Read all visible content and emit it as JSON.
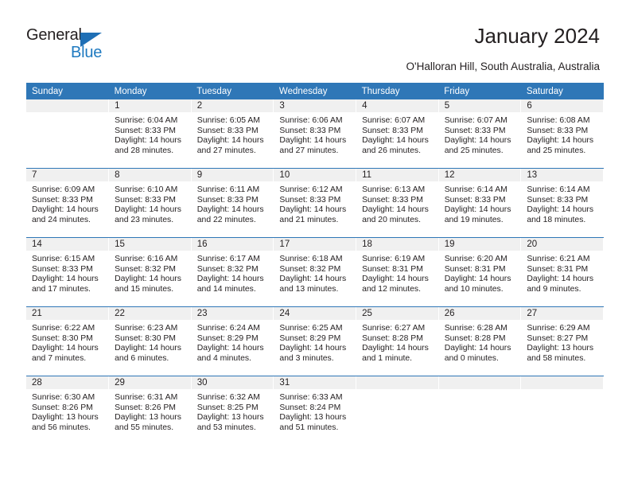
{
  "brand": {
    "name_part1": "General",
    "name_part2": "Blue",
    "accent_color": "#1f7ac0",
    "triangle_color": "#1f6fb5"
  },
  "header": {
    "title": "January 2024",
    "subtitle": "O'Halloran Hill, South Australia, Australia"
  },
  "calendar": {
    "header_bg": "#2f77b7",
    "date_bar_bg": "#f0f0f0",
    "weekday_labels": [
      "Sunday",
      "Monday",
      "Tuesday",
      "Wednesday",
      "Thursday",
      "Friday",
      "Saturday"
    ],
    "weeks": [
      [
        {
          "date": "",
          "sunrise": "",
          "sunset": "",
          "daylight_line1": "",
          "daylight_line2": ""
        },
        {
          "date": "1",
          "sunrise": "Sunrise: 6:04 AM",
          "sunset": "Sunset: 8:33 PM",
          "daylight_line1": "Daylight: 14 hours",
          "daylight_line2": "and 28 minutes."
        },
        {
          "date": "2",
          "sunrise": "Sunrise: 6:05 AM",
          "sunset": "Sunset: 8:33 PM",
          "daylight_line1": "Daylight: 14 hours",
          "daylight_line2": "and 27 minutes."
        },
        {
          "date": "3",
          "sunrise": "Sunrise: 6:06 AM",
          "sunset": "Sunset: 8:33 PM",
          "daylight_line1": "Daylight: 14 hours",
          "daylight_line2": "and 27 minutes."
        },
        {
          "date": "4",
          "sunrise": "Sunrise: 6:07 AM",
          "sunset": "Sunset: 8:33 PM",
          "daylight_line1": "Daylight: 14 hours",
          "daylight_line2": "and 26 minutes."
        },
        {
          "date": "5",
          "sunrise": "Sunrise: 6:07 AM",
          "sunset": "Sunset: 8:33 PM",
          "daylight_line1": "Daylight: 14 hours",
          "daylight_line2": "and 25 minutes."
        },
        {
          "date": "6",
          "sunrise": "Sunrise: 6:08 AM",
          "sunset": "Sunset: 8:33 PM",
          "daylight_line1": "Daylight: 14 hours",
          "daylight_line2": "and 25 minutes."
        }
      ],
      [
        {
          "date": "7",
          "sunrise": "Sunrise: 6:09 AM",
          "sunset": "Sunset: 8:33 PM",
          "daylight_line1": "Daylight: 14 hours",
          "daylight_line2": "and 24 minutes."
        },
        {
          "date": "8",
          "sunrise": "Sunrise: 6:10 AM",
          "sunset": "Sunset: 8:33 PM",
          "daylight_line1": "Daylight: 14 hours",
          "daylight_line2": "and 23 minutes."
        },
        {
          "date": "9",
          "sunrise": "Sunrise: 6:11 AM",
          "sunset": "Sunset: 8:33 PM",
          "daylight_line1": "Daylight: 14 hours",
          "daylight_line2": "and 22 minutes."
        },
        {
          "date": "10",
          "sunrise": "Sunrise: 6:12 AM",
          "sunset": "Sunset: 8:33 PM",
          "daylight_line1": "Daylight: 14 hours",
          "daylight_line2": "and 21 minutes."
        },
        {
          "date": "11",
          "sunrise": "Sunrise: 6:13 AM",
          "sunset": "Sunset: 8:33 PM",
          "daylight_line1": "Daylight: 14 hours",
          "daylight_line2": "and 20 minutes."
        },
        {
          "date": "12",
          "sunrise": "Sunrise: 6:14 AM",
          "sunset": "Sunset: 8:33 PM",
          "daylight_line1": "Daylight: 14 hours",
          "daylight_line2": "and 19 minutes."
        },
        {
          "date": "13",
          "sunrise": "Sunrise: 6:14 AM",
          "sunset": "Sunset: 8:33 PM",
          "daylight_line1": "Daylight: 14 hours",
          "daylight_line2": "and 18 minutes."
        }
      ],
      [
        {
          "date": "14",
          "sunrise": "Sunrise: 6:15 AM",
          "sunset": "Sunset: 8:33 PM",
          "daylight_line1": "Daylight: 14 hours",
          "daylight_line2": "and 17 minutes."
        },
        {
          "date": "15",
          "sunrise": "Sunrise: 6:16 AM",
          "sunset": "Sunset: 8:32 PM",
          "daylight_line1": "Daylight: 14 hours",
          "daylight_line2": "and 15 minutes."
        },
        {
          "date": "16",
          "sunrise": "Sunrise: 6:17 AM",
          "sunset": "Sunset: 8:32 PM",
          "daylight_line1": "Daylight: 14 hours",
          "daylight_line2": "and 14 minutes."
        },
        {
          "date": "17",
          "sunrise": "Sunrise: 6:18 AM",
          "sunset": "Sunset: 8:32 PM",
          "daylight_line1": "Daylight: 14 hours",
          "daylight_line2": "and 13 minutes."
        },
        {
          "date": "18",
          "sunrise": "Sunrise: 6:19 AM",
          "sunset": "Sunset: 8:31 PM",
          "daylight_line1": "Daylight: 14 hours",
          "daylight_line2": "and 12 minutes."
        },
        {
          "date": "19",
          "sunrise": "Sunrise: 6:20 AM",
          "sunset": "Sunset: 8:31 PM",
          "daylight_line1": "Daylight: 14 hours",
          "daylight_line2": "and 10 minutes."
        },
        {
          "date": "20",
          "sunrise": "Sunrise: 6:21 AM",
          "sunset": "Sunset: 8:31 PM",
          "daylight_line1": "Daylight: 14 hours",
          "daylight_line2": "and 9 minutes."
        }
      ],
      [
        {
          "date": "21",
          "sunrise": "Sunrise: 6:22 AM",
          "sunset": "Sunset: 8:30 PM",
          "daylight_line1": "Daylight: 14 hours",
          "daylight_line2": "and 7 minutes."
        },
        {
          "date": "22",
          "sunrise": "Sunrise: 6:23 AM",
          "sunset": "Sunset: 8:30 PM",
          "daylight_line1": "Daylight: 14 hours",
          "daylight_line2": "and 6 minutes."
        },
        {
          "date": "23",
          "sunrise": "Sunrise: 6:24 AM",
          "sunset": "Sunset: 8:29 PM",
          "daylight_line1": "Daylight: 14 hours",
          "daylight_line2": "and 4 minutes."
        },
        {
          "date": "24",
          "sunrise": "Sunrise: 6:25 AM",
          "sunset": "Sunset: 8:29 PM",
          "daylight_line1": "Daylight: 14 hours",
          "daylight_line2": "and 3 minutes."
        },
        {
          "date": "25",
          "sunrise": "Sunrise: 6:27 AM",
          "sunset": "Sunset: 8:28 PM",
          "daylight_line1": "Daylight: 14 hours",
          "daylight_line2": "and 1 minute."
        },
        {
          "date": "26",
          "sunrise": "Sunrise: 6:28 AM",
          "sunset": "Sunset: 8:28 PM",
          "daylight_line1": "Daylight: 14 hours",
          "daylight_line2": "and 0 minutes."
        },
        {
          "date": "27",
          "sunrise": "Sunrise: 6:29 AM",
          "sunset": "Sunset: 8:27 PM",
          "daylight_line1": "Daylight: 13 hours",
          "daylight_line2": "and 58 minutes."
        }
      ],
      [
        {
          "date": "28",
          "sunrise": "Sunrise: 6:30 AM",
          "sunset": "Sunset: 8:26 PM",
          "daylight_line1": "Daylight: 13 hours",
          "daylight_line2": "and 56 minutes."
        },
        {
          "date": "29",
          "sunrise": "Sunrise: 6:31 AM",
          "sunset": "Sunset: 8:26 PM",
          "daylight_line1": "Daylight: 13 hours",
          "daylight_line2": "and 55 minutes."
        },
        {
          "date": "30",
          "sunrise": "Sunrise: 6:32 AM",
          "sunset": "Sunset: 8:25 PM",
          "daylight_line1": "Daylight: 13 hours",
          "daylight_line2": "and 53 minutes."
        },
        {
          "date": "31",
          "sunrise": "Sunrise: 6:33 AM",
          "sunset": "Sunset: 8:24 PM",
          "daylight_line1": "Daylight: 13 hours",
          "daylight_line2": "and 51 minutes."
        },
        {
          "date": "",
          "sunrise": "",
          "sunset": "",
          "daylight_line1": "",
          "daylight_line2": ""
        },
        {
          "date": "",
          "sunrise": "",
          "sunset": "",
          "daylight_line1": "",
          "daylight_line2": ""
        },
        {
          "date": "",
          "sunrise": "",
          "sunset": "",
          "daylight_line1": "",
          "daylight_line2": ""
        }
      ]
    ]
  }
}
